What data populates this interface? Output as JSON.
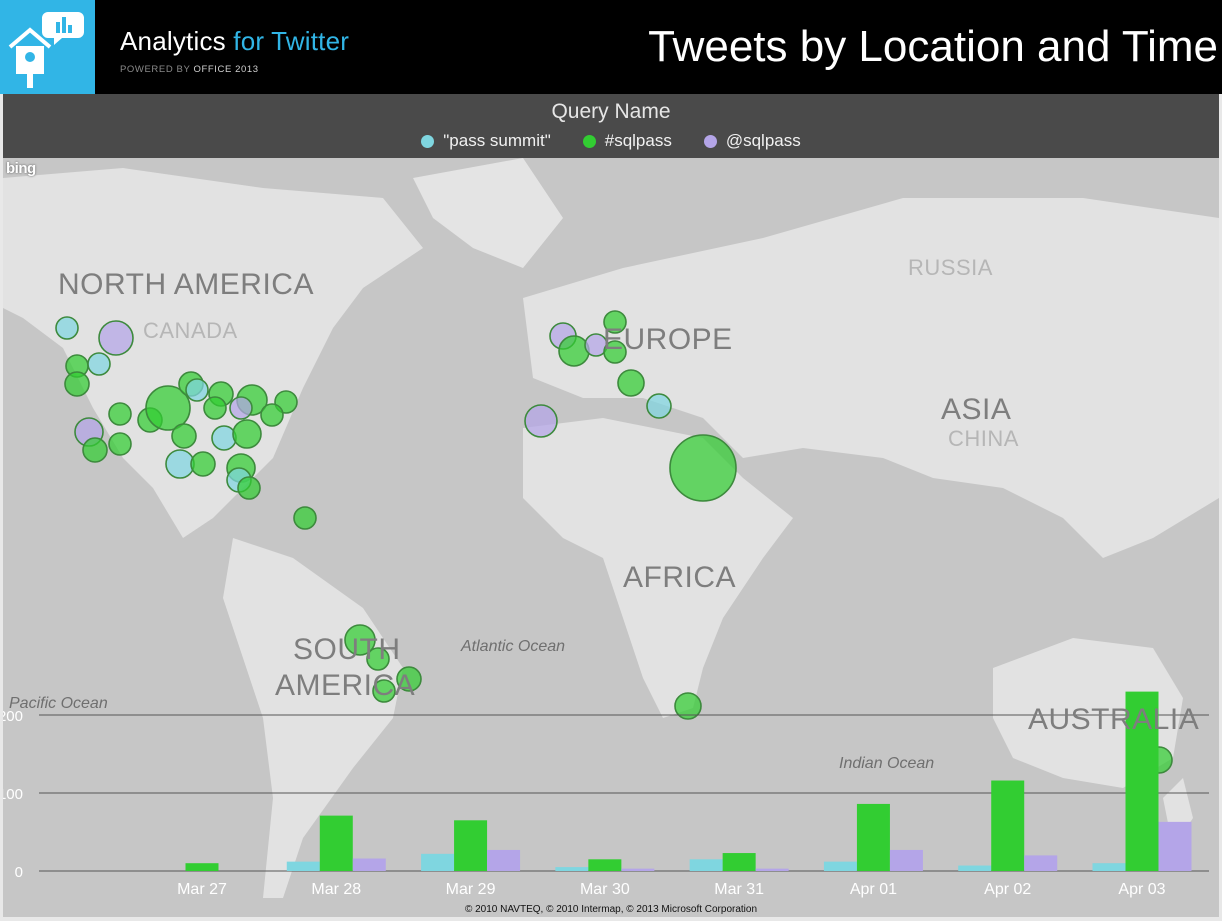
{
  "app": {
    "name_main": "Analytics ",
    "name_accent": "for Twitter",
    "powered_prefix": "POWERED BY ",
    "powered_product": "OFFICE 2013"
  },
  "page_title": "Tweets by Location and Time",
  "legend": {
    "title": "Query Name",
    "items": [
      {
        "label": "\"pass summit\"",
        "color": "#7fd6e0"
      },
      {
        "label": "#sqlpass",
        "color": "#32cd32"
      },
      {
        "label": "@sqlpass",
        "color": "#b4a5e8"
      }
    ]
  },
  "map": {
    "provider": "bing",
    "labels": {
      "north_america": "NORTH AMERICA",
      "canada": "CANADA",
      "europe": "EUROPE",
      "russia": "RUSSIA",
      "asia": "ASIA",
      "china": "CHINA",
      "africa": "AFRICA",
      "south_america_1": "SOUTH",
      "south_america_2": "AMERICA",
      "australia": "AUSTRALIA"
    },
    "oceans": {
      "atlantic": "Atlantic Ocean",
      "pacific": "Pacific Ocean",
      "indian": "Indian Ocean"
    },
    "copyright": "© 2010 NAVTEQ, © 2010 Intermap, © 2013 Microsoft Corporation"
  },
  "chart_data": {
    "type": "bar",
    "categories": [
      "Mar 27",
      "Mar 28",
      "Mar 29",
      "Mar 30",
      "Mar 31",
      "Apr 01",
      "Apr 02",
      "Apr 03"
    ],
    "series": [
      {
        "name": "\"pass summit\"",
        "color": "#7fd6e0",
        "values": [
          0,
          12,
          22,
          5,
          15,
          12,
          7,
          10
        ]
      },
      {
        "name": "#sqlpass",
        "color": "#32cd32",
        "values": [
          10,
          71,
          65,
          15,
          23,
          86,
          116,
          230
        ]
      },
      {
        "name": "@sqlpass",
        "color": "#b4a5e8",
        "values": [
          0,
          16,
          27,
          3,
          3,
          27,
          20,
          63
        ]
      }
    ],
    "y_ticks": [
      0,
      100,
      200
    ],
    "ylim": [
      0,
      230
    ],
    "grid": true,
    "legend": "top"
  }
}
